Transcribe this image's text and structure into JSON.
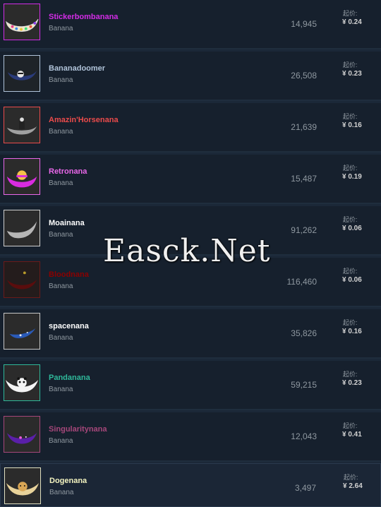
{
  "items": [
    {
      "name": "Stickerbombanana",
      "game": "Banana",
      "quantity": "14,945",
      "price_label": "起价:",
      "price": "¥ 0.24",
      "name_color": "#d32ce6",
      "border_color": "#d32ce6",
      "icon": "stickerbomb-banana-icon"
    },
    {
      "name": "Bananadoomer",
      "game": "Banana",
      "quantity": "26,508",
      "price_label": "起价:",
      "price": "¥ 0.23",
      "name_color": "#b0c3d9",
      "border_color": "#b0c3d9",
      "icon": "doomer-banana-icon"
    },
    {
      "name": "Amazin'Horsenana",
      "game": "Banana",
      "quantity": "21,639",
      "price_label": "起价:",
      "price": "¥ 0.16",
      "name_color": "#eb4b4b",
      "border_color": "#eb4b4b",
      "icon": "horse-banana-icon"
    },
    {
      "name": "Retronana",
      "game": "Banana",
      "quantity": "15,487",
      "price_label": "起价:",
      "price": "¥ 0.19",
      "name_color": "#e967e9",
      "border_color": "#e967e9",
      "icon": "retro-banana-icon"
    },
    {
      "name": "Moainana",
      "game": "Banana",
      "quantity": "91,262",
      "price_label": "起价:",
      "price": "¥ 0.06",
      "name_color": "#ffffff",
      "border_color": "#d0d0d0",
      "icon": "moai-banana-icon"
    },
    {
      "name": "Bloodnana",
      "game": "Banana",
      "quantity": "116,460",
      "price_label": "起价:",
      "price": "¥ 0.06",
      "name_color": "#8b0000",
      "border_color": "#6a1a1a",
      "icon": "blood-banana-icon"
    },
    {
      "name": "spacenana",
      "game": "Banana",
      "quantity": "35,826",
      "price_label": "起价:",
      "price": "¥ 0.16",
      "name_color": "#ffffff",
      "border_color": "#c8c8c8",
      "icon": "space-banana-icon"
    },
    {
      "name": "Pandanana",
      "game": "Banana",
      "quantity": "59,215",
      "price_label": "起价:",
      "price": "¥ 0.23",
      "name_color": "#2fb89a",
      "border_color": "#2fb89a",
      "icon": "panda-banana-icon"
    },
    {
      "name": "Singularitynana",
      "game": "Banana",
      "quantity": "12,043",
      "price_label": "起价:",
      "price": "¥ 0.41",
      "name_color": "#a6477a",
      "border_color": "#a6477a",
      "icon": "singularity-banana-icon"
    },
    {
      "name": "Dogenana",
      "game": "Banana",
      "quantity": "3,497",
      "price_label": "起价:",
      "price": "¥ 2.64",
      "name_color": "#f3f3c0",
      "border_color": "#e0e0c0",
      "icon": "doge-banana-icon"
    }
  ],
  "watermark": "Easck.Net"
}
